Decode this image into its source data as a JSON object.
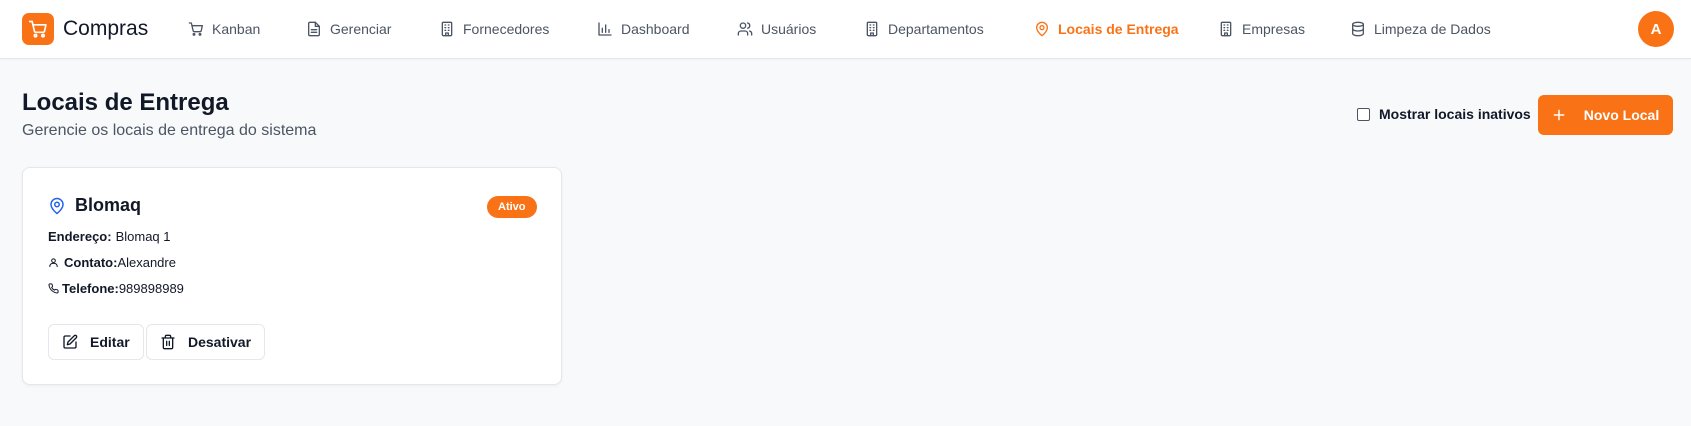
{
  "app": {
    "name": "Compras",
    "user_initial": "A"
  },
  "nav": {
    "items": [
      {
        "label": "Kanban",
        "icon": "cart-icon"
      },
      {
        "label": "Gerenciar",
        "icon": "file-icon"
      },
      {
        "label": "Fornecedores",
        "icon": "building-icon"
      },
      {
        "label": "Dashboard",
        "icon": "bar-chart-icon"
      },
      {
        "label": "Usuários",
        "icon": "users-icon"
      },
      {
        "label": "Departamentos",
        "icon": "building-icon"
      },
      {
        "label": "Locais de Entrega",
        "icon": "map-pin-icon",
        "active": true
      },
      {
        "label": "Empresas",
        "icon": "building-icon"
      },
      {
        "label": "Limpeza de Dados",
        "icon": "database-icon"
      }
    ]
  },
  "page": {
    "title": "Locais de Entrega",
    "subtitle": "Gerencie os locais de entrega do sistema",
    "show_inactive_label": "Mostrar locais inativos",
    "show_inactive_checked": false,
    "new_button_label": "Novo Local"
  },
  "locations": [
    {
      "name": "Blomaq",
      "status": "Ativo",
      "address_label": "Endereço:",
      "address": "Blomaq 1",
      "contact_label": "Contato:",
      "contact": "Alexandre",
      "phone_label": "Telefone:",
      "phone": "989898989",
      "edit_label": "Editar",
      "deactivate_label": "Desativar"
    }
  ],
  "colors": {
    "accent": "#f97316",
    "pin_blue": "#2563eb",
    "text": "#111827",
    "muted": "#4b5563"
  }
}
